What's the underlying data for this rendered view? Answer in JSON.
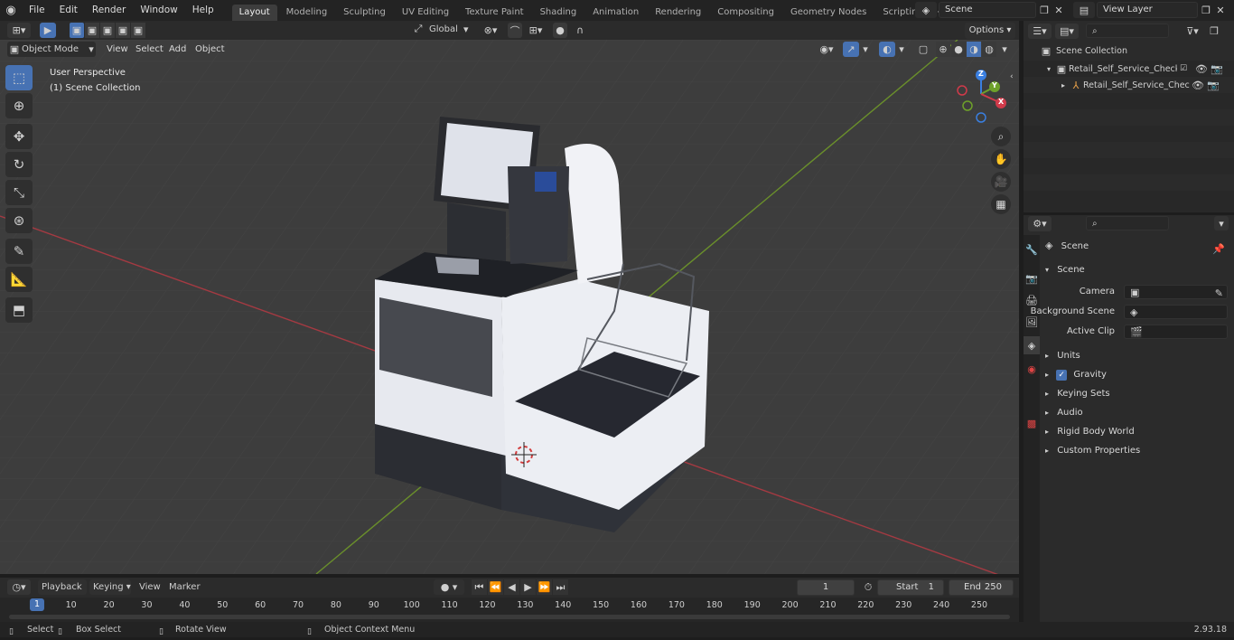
{
  "topbar": {
    "menus": [
      "File",
      "Edit",
      "Render",
      "Window",
      "Help"
    ],
    "workspaces": [
      "Layout",
      "Modeling",
      "Sculpting",
      "UV Editing",
      "Texture Paint",
      "Shading",
      "Animation",
      "Rendering",
      "Compositing",
      "Geometry Nodes",
      "Scripting"
    ],
    "active_workspace": "Layout",
    "scene_name": "Scene",
    "view_layer": "View Layer"
  },
  "viewport_header": {
    "mode": "Object Mode",
    "menus": [
      "View",
      "Select",
      "Add",
      "Object"
    ],
    "orientation": "Global",
    "options_label": "Options"
  },
  "viewport": {
    "perspective_label": "User Perspective",
    "collection_label": "(1) Scene Collection",
    "axis_labels": {
      "x": "X",
      "y": "Y",
      "z": "Z"
    }
  },
  "outliner": {
    "root": "Scene Collection",
    "items": [
      {
        "label": "Retail_Self_Service_Checkout"
      },
      {
        "label": "Retail_Self_Service_Chec"
      }
    ]
  },
  "properties": {
    "header": "Scene",
    "panel_title": "Scene",
    "fields": [
      {
        "label": "Camera",
        "value": ""
      },
      {
        "label": "Background Scene",
        "value": ""
      },
      {
        "label": "Active Clip",
        "value": ""
      }
    ],
    "sections": [
      "Units",
      "Gravity",
      "Keying Sets",
      "Audio",
      "Rigid Body World",
      "Custom Properties"
    ],
    "gravity_checked": true
  },
  "timeline": {
    "menus": [
      "Playback",
      "Keying",
      "View",
      "Marker"
    ],
    "current_frame": "1",
    "start_label": "Start",
    "start_value": "1",
    "end_label": "End",
    "end_value": "250",
    "ruler": [
      "1",
      "10",
      "20",
      "30",
      "40",
      "50",
      "60",
      "70",
      "80",
      "90",
      "100",
      "110",
      "120",
      "130",
      "140",
      "150",
      "160",
      "170",
      "180",
      "190",
      "200",
      "210",
      "220",
      "230",
      "240",
      "250"
    ]
  },
  "statusbar": {
    "select": "Select",
    "box_select": "Box Select",
    "rotate_view": "Rotate View",
    "context_menu": "Object Context Menu",
    "version": "2.93.18"
  },
  "colors": {
    "accent": "#4772b3",
    "x_axis": "#d03a4a",
    "y_axis": "#6ea12a",
    "z_axis": "#3a7fe0"
  }
}
